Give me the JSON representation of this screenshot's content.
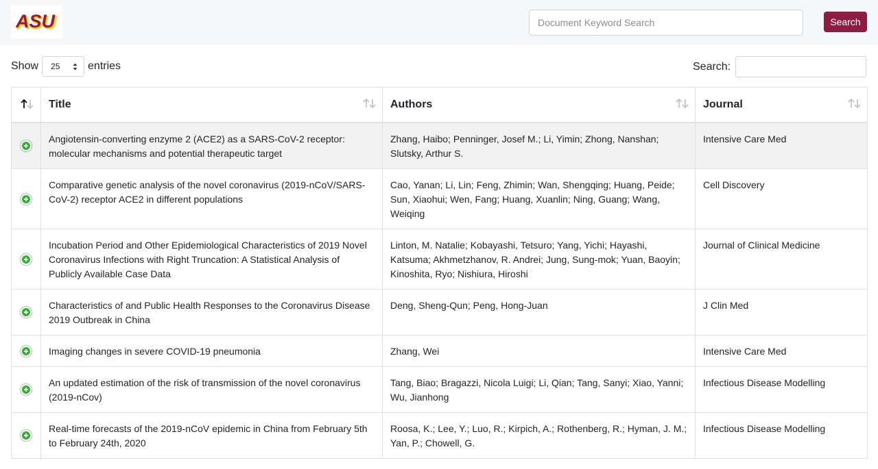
{
  "header": {
    "logo_text": "ASU",
    "keyword_placeholder": "Document Keyword Search",
    "search_button": "Search"
  },
  "length_menu": {
    "show_label": "Show",
    "selected": "25",
    "entries_label": "entries"
  },
  "filter": {
    "label": "Search:",
    "value": ""
  },
  "table": {
    "columns": [
      {
        "label": ""
      },
      {
        "label": "Title"
      },
      {
        "label": "Authors"
      },
      {
        "label": "Journal"
      }
    ],
    "rows": [
      {
        "title": "Angiotensin-converting enzyme 2 (ACE2) as a SARS-CoV-2 receptor: molecular mechanisms and potential therapeutic target",
        "authors": "Zhang, Haibo; Penninger, Josef M.; Li, Yimin; Zhong, Nanshan; Slutsky, Arthur S.",
        "journal": "Intensive Care Med"
      },
      {
        "title": "Comparative genetic analysis of the novel coronavirus (2019-nCoV/SARS-CoV-2) receptor ACE2 in different populations",
        "authors": "Cao, Yanan; Li, Lin; Feng, Zhimin; Wan, Shengqing; Huang, Peide; Sun, Xiaohui; Wen, Fang; Huang, Xuanlin; Ning, Guang; Wang, Weiqing",
        "journal": "Cell Discovery"
      },
      {
        "title": "Incubation Period and Other Epidemiological Characteristics of 2019 Novel Coronavirus Infections with Right Truncation: A Statistical Analysis of Publicly Available Case Data",
        "authors": "Linton, M. Natalie; Kobayashi, Tetsuro; Yang, Yichi; Hayashi, Katsuma; Akhmetzhanov, R. Andrei; Jung, Sung-mok; Yuan, Baoyin; Kinoshita, Ryo; Nishiura, Hiroshi",
        "journal": "Journal of Clinical Medicine"
      },
      {
        "title": "Characteristics of and Public Health Responses to the Coronavirus Disease 2019 Outbreak in China",
        "authors": "Deng, Sheng-Qun; Peng, Hong-Juan",
        "journal": "J Clin Med"
      },
      {
        "title": "Imaging changes in severe COVID-19 pneumonia",
        "authors": "Zhang, Wei",
        "journal": "Intensive Care Med"
      },
      {
        "title": "An updated estimation of the risk of transmission of the novel coronavirus (2019-nCov)",
        "authors": "Tang, Biao; Bragazzi, Nicola Luigi; Li, Qian; Tang, Sanyi; Xiao, Yanni; Wu, Jianhong",
        "journal": "Infectious Disease Modelling"
      },
      {
        "title": "Real-time forecasts of the 2019-nCoV epidemic in China from February 5th to February 24th, 2020",
        "authors": "Roosa, K.; Lee, Y.; Luo, R.; Kirpich, A.; Rothenberg, R.; Hyman, J. M.; Yan, P.; Chowell, G.",
        "journal": "Infectious Disease Modelling"
      }
    ]
  },
  "colors": {
    "brand_maroon": "#8c1d40",
    "brand_gold": "#ffc627",
    "expand_green": "#31b131",
    "stripe": "#f2f2f2"
  }
}
